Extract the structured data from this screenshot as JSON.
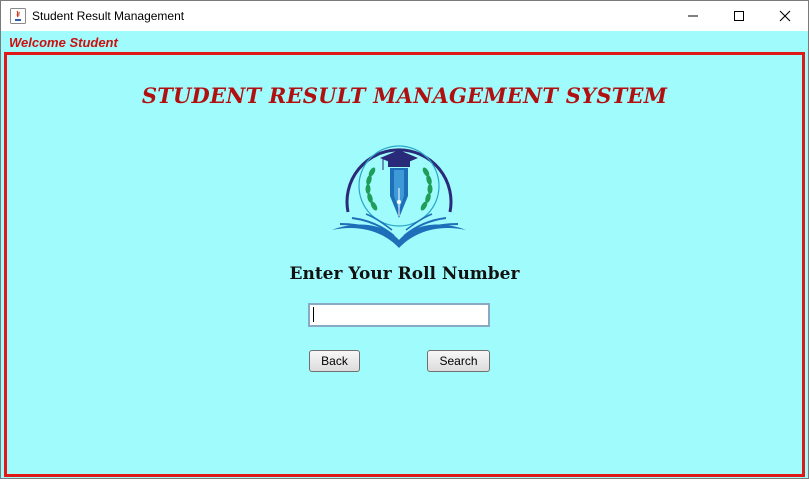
{
  "window": {
    "title": "Student Result Management",
    "controls": {
      "minimize": "minimize-icon",
      "maximize": "maximize-icon",
      "close": "close-icon"
    }
  },
  "header": {
    "welcome": "Welcome Student"
  },
  "main": {
    "system_title": "STUDENT RESULT MANAGEMENT SYSTEM",
    "logo": "graduation-pen-book-logo-icon",
    "roll_label": "Enter Your Roll Number",
    "roll_input": {
      "value": "",
      "placeholder": ""
    },
    "back_label": "Back",
    "search_label": "Search"
  },
  "colors": {
    "background": "#a0fcfc",
    "panel_border": "#e01818",
    "title": "#b01010",
    "welcome": "#cc1010",
    "logo_blue": "#1c6fb8",
    "logo_navy": "#2a2a7a",
    "logo_green": "#1f9e5a"
  }
}
